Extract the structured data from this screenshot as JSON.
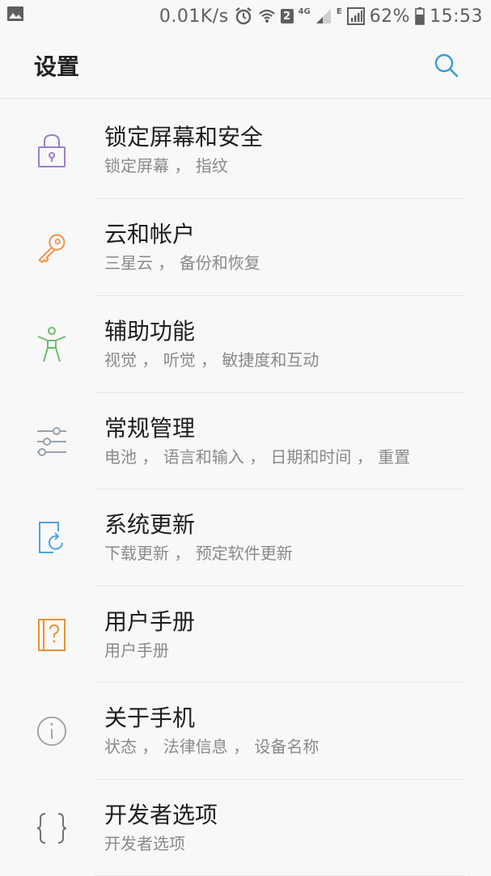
{
  "status_bar": {
    "net_speed": "0.01K/s",
    "sim_number": "2",
    "network_4g": "4G",
    "network_e": "E",
    "battery": "62%",
    "time": "15:53"
  },
  "header": {
    "title": "设置"
  },
  "settings": [
    {
      "title": "锁定屏幕和安全",
      "subtitle": "锁定屏幕 ， 指纹",
      "icon": "lock-icon",
      "color": "#9b7fcf"
    },
    {
      "title": "云和帐户",
      "subtitle": "三星云 ， 备份和恢复",
      "icon": "key-icon",
      "color": "#f0934a"
    },
    {
      "title": "辅助功能",
      "subtitle": "视觉 ， 听觉 ， 敏捷度和互动",
      "icon": "accessibility-icon",
      "color": "#6dbb6d"
    },
    {
      "title": "常规管理",
      "subtitle": "电池 ， 语言和输入 ， 日期和时间 ， 重置",
      "icon": "sliders-icon",
      "color": "#9aa3ab"
    },
    {
      "title": "系统更新",
      "subtitle": "下载更新 ， 预定软件更新",
      "icon": "system-update-icon",
      "color": "#4fa3e0"
    },
    {
      "title": "用户手册",
      "subtitle": "用户手册",
      "icon": "user-manual-icon",
      "color": "#e8913a"
    },
    {
      "title": "关于手机",
      "subtitle": "状态 ， 法律信息 ， 设备名称",
      "icon": "info-icon",
      "color": "#9aa3ab"
    },
    {
      "title": "开发者选项",
      "subtitle": "开发者选项",
      "icon": "braces-icon",
      "color": "#6d7378"
    }
  ],
  "accent": "#3a9ad9"
}
